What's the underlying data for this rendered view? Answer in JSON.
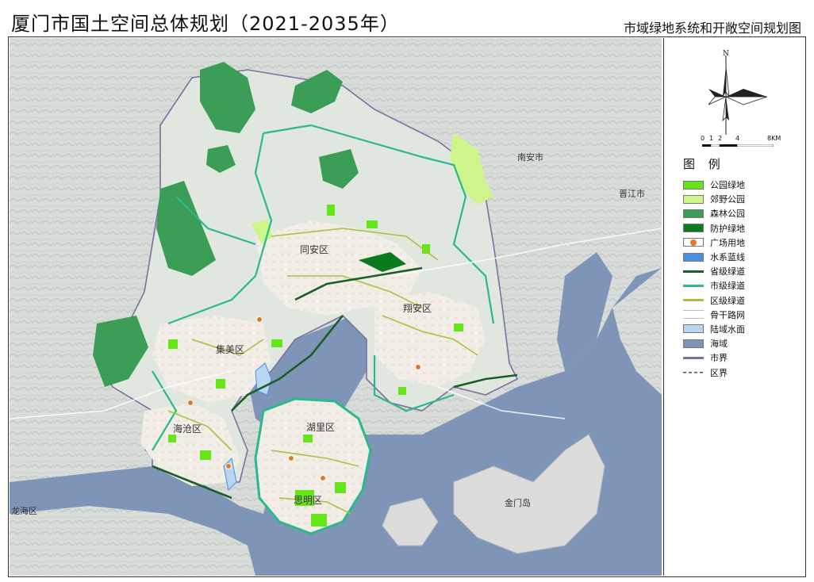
{
  "header": {
    "title": "厦门市国土空间总体规划（2021-2035年）",
    "subtitle": "市域绿地系统和开敞空间规划图"
  },
  "legend": {
    "title": "图 例",
    "north_label": "N",
    "scale_labels": [
      "0",
      "1",
      "2",
      "4",
      "8KM"
    ],
    "items": [
      {
        "label": "公园绿地",
        "kind": "fill",
        "color": "#66e61a"
      },
      {
        "label": "郊野公园",
        "kind": "fill",
        "color": "#cdf58c"
      },
      {
        "label": "森林公园",
        "kind": "fill",
        "color": "#3c9e56"
      },
      {
        "label": "防护绿地",
        "kind": "fill",
        "color": "#0a7a1e"
      },
      {
        "label": "广场用地",
        "kind": "dot",
        "color": "#e07a2a"
      },
      {
        "label": "水系蓝线",
        "kind": "fill",
        "color": "#4b8fe0"
      },
      {
        "label": "省级绿道",
        "kind": "line",
        "color": "#1a5e2a"
      },
      {
        "label": "市级绿道",
        "kind": "line",
        "color": "#2bb98a"
      },
      {
        "label": "区级绿道",
        "kind": "line",
        "color": "#a9c23c"
      },
      {
        "label": "骨干路网",
        "kind": "road",
        "color": "#bfbfbf"
      },
      {
        "label": "陆域水面",
        "kind": "fill",
        "color": "#b8d6f2"
      },
      {
        "label": "海域",
        "kind": "fill",
        "color": "#7f95b8"
      },
      {
        "label": "市界",
        "kind": "line",
        "color": "#7b6fa6"
      },
      {
        "label": "区界",
        "kind": "dash",
        "color": "#555555"
      }
    ]
  },
  "map": {
    "districts": [
      "同安区",
      "翔安区",
      "集美区",
      "海沧区",
      "湖里区",
      "思明区"
    ],
    "places": [
      "金门岛",
      "龙海区",
      "南安市",
      "晋江市"
    ]
  }
}
